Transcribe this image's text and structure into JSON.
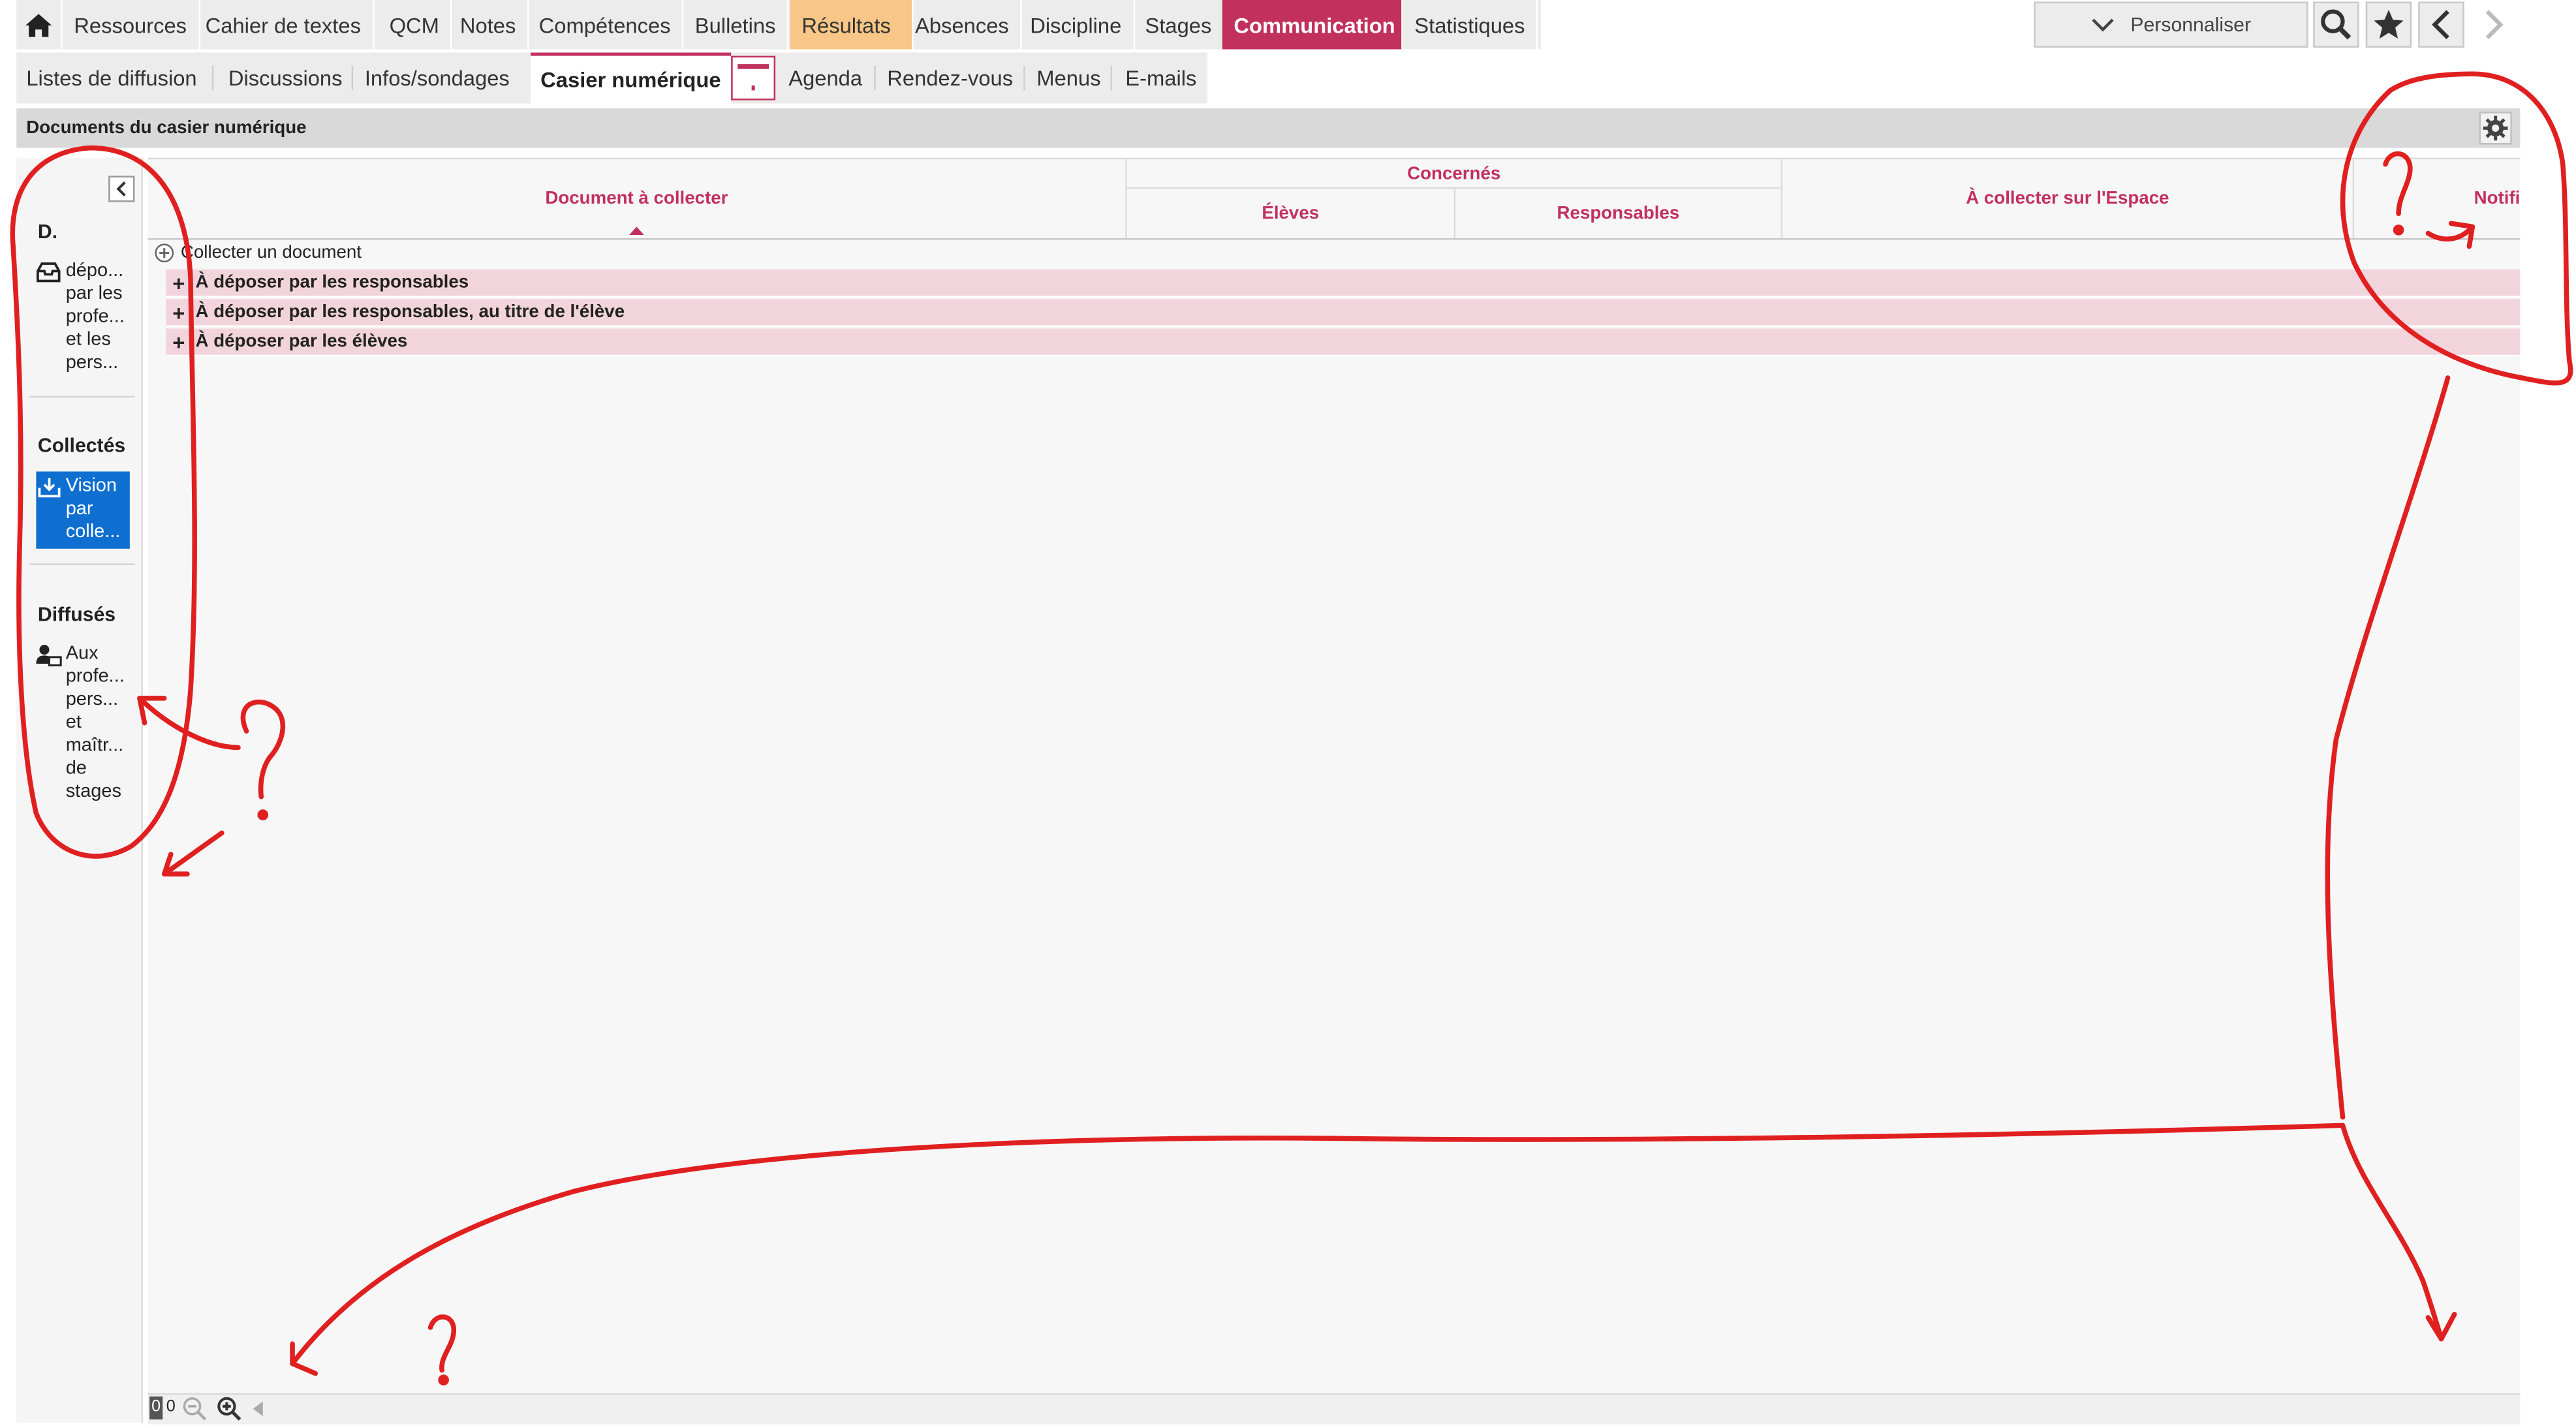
{
  "top_menu": {
    "home_icon": "home-icon",
    "items": [
      "Ressources",
      "Cahier de textes",
      "QCM",
      "Notes",
      "Compétences",
      "Bulletins",
      "Résultats",
      "Absences",
      "Discipline",
      "Stages",
      "Communication",
      "Statistiques"
    ],
    "active": "Communication",
    "highlighted": "Résultats",
    "personnaliser_label": "Personnaliser"
  },
  "sub_menu": {
    "items": [
      "Listes de diffusion",
      "Discussions",
      "Infos/sondages",
      "Casier numérique",
      "Agenda",
      "Rendez-vous",
      "Menus",
      "E-mails"
    ],
    "active": "Casier numérique"
  },
  "page_title": "Documents du casier numérique",
  "left_panel": {
    "section_d": "D.",
    "depot_item": [
      "dépo...",
      "par les",
      "profe...",
      "et les",
      "pers..."
    ],
    "section_collectes": "Collectés",
    "vision_item": [
      "Vision",
      "par",
      "colle..."
    ],
    "section_diffuses": "Diffusés",
    "aux_item": [
      "Aux",
      "profe...",
      "pers...",
      "et",
      "maîtr...",
      "de",
      "stages"
    ]
  },
  "grid": {
    "col_document": "Document à collecter",
    "col_concernes": "Concernés",
    "col_eleves": "Élèves",
    "col_responsables": "Responsables",
    "col_espace": "À collecter sur l'Espace",
    "col_notif": "Notifi",
    "collect_link": "Collecter un document",
    "groups": [
      "À déposer par les responsables",
      "À déposer par les responsables, au titre de l'élève",
      "À déposer par les élèves"
    ]
  },
  "bottom_bar": {
    "counter_a": "0",
    "counter_b": "0"
  },
  "colors": {
    "accent": "#c2305d",
    "selected": "#0f6fd1",
    "group_bg": "#f2d4dc",
    "results_tab": "#f8c787",
    "annotation": "#e02020"
  }
}
